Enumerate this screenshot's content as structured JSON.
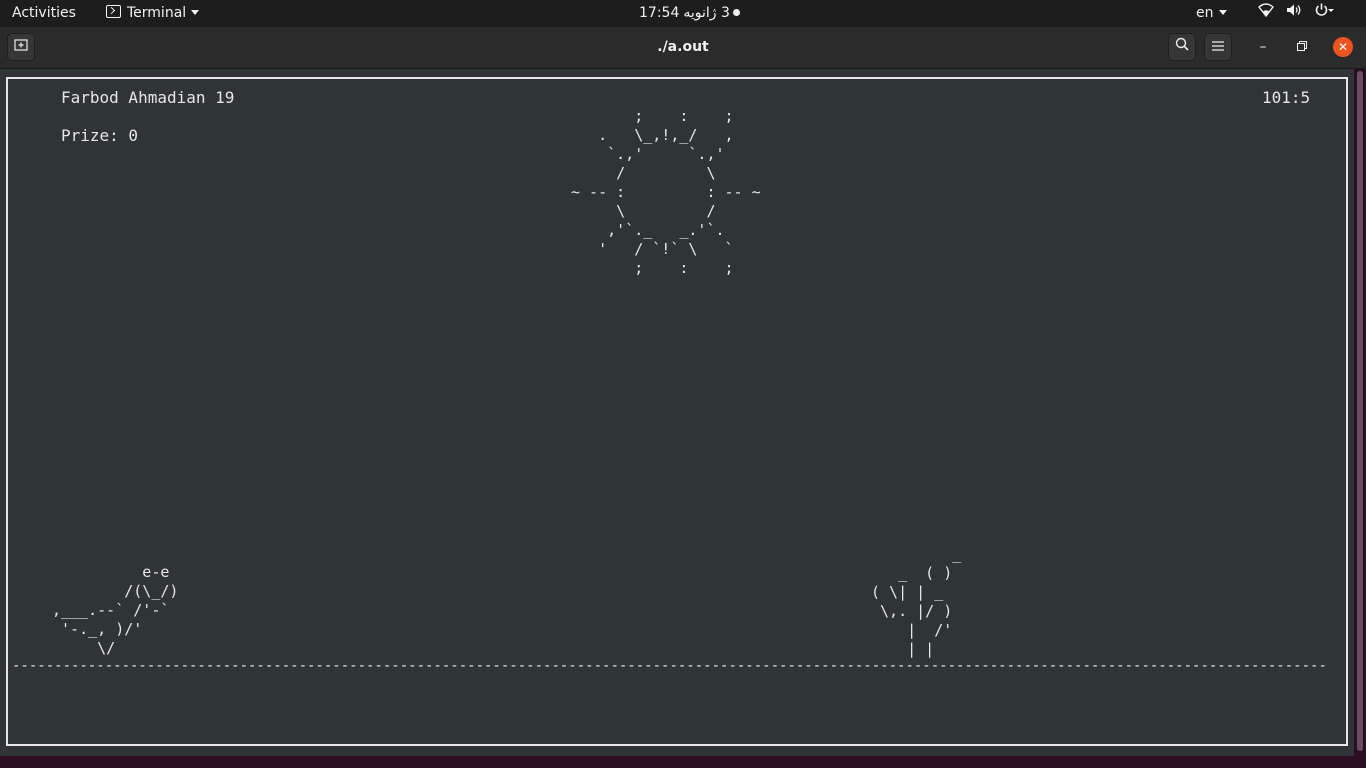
{
  "topbar": {
    "activities": "Activities",
    "app_name": "Terminal",
    "time": "17:54",
    "date": "3 ژانویه",
    "language": "en"
  },
  "window": {
    "title": "./a.out",
    "close_glyph": "✕",
    "minimize_glyph": "–",
    "maximize_glyph": "❐"
  },
  "game": {
    "player": "Farbod Ahmadian 19",
    "prize": "Prize: 0",
    "score": "101:5",
    "sun_art": "       ;    :    ;\n   .   \\_,!,_/   ,\n    `.,'     `.,'\n     /         \\\n~ -- :         : -- ~\n     \\         /\n    ,'`._   _.'`.\n   '   / `!` \\   `\n       ;    :    ;",
    "dino_art": "          e-e\n        /(\\_/)\n,___.--` /'-`\n '-._, )/'\n     \\/",
    "cactus_art": "         _\n   _  ( )\n( \\| | _\n \\,. |/ )\n    |  /'\n    | |",
    "ground": "------------------------------------------------------------------------------------------------------------------------------------------------------------------"
  },
  "icons": {
    "newtab": "new-tab-icon",
    "search": "search-icon",
    "menu": "hamburger-menu-icon",
    "network": "network-icon",
    "volume": "volume-icon",
    "power": "power-icon"
  },
  "colors": {
    "terminal_bg": "#2f3437",
    "terminal_fg": "#e6e6e6",
    "topbar_bg": "#1d1d1d",
    "close_accent": "#e95420",
    "desktop_bg": "#2c0e22"
  }
}
